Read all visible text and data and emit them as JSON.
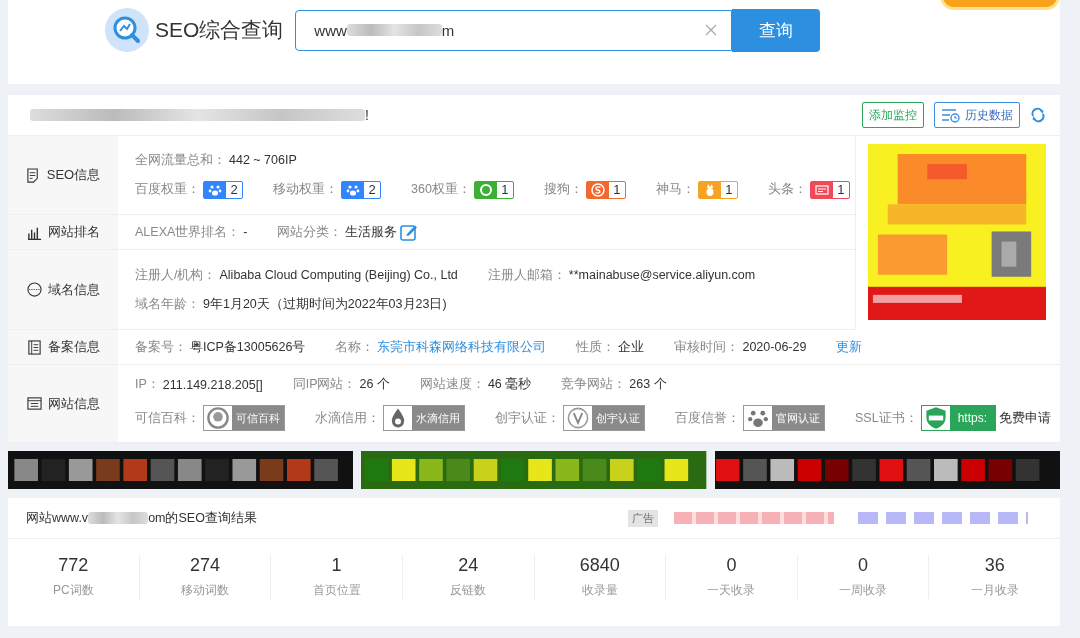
{
  "header": {
    "title": "SEO综合查询",
    "search": {
      "value_start": "www",
      "value_end": "m"
    },
    "button": "查询"
  },
  "report": {
    "title_end": "!",
    "actions": [
      {
        "label": "添加监控",
        "kind": "monitor"
      },
      {
        "label": "历史数据",
        "kind": "history"
      }
    ],
    "sections": [
      {
        "label": "SEO信息",
        "lines": [
          [
            {
              "kind": "text",
              "label": "全网流量总和：",
              "value": "442 ~ 706IP"
            }
          ],
          [
            {
              "kind": "weight",
              "label": "百度权重：",
              "color": "#3385ff",
              "value": "2"
            },
            {
              "kind": "weight",
              "label": "移动权重：",
              "color": "#3385ff",
              "value": "2"
            },
            {
              "kind": "weight",
              "label": "360权重：",
              "color": "#3cb034",
              "value": "1"
            },
            {
              "kind": "weight",
              "label": "搜狗：",
              "color": "#f2682e",
              "value": "1"
            },
            {
              "kind": "weight",
              "label": "神马：",
              "color": "#f5a322",
              "value": "1"
            },
            {
              "kind": "weight",
              "label": "头条：",
              "color": "#f04a5a",
              "value": "1"
            }
          ]
        ]
      },
      {
        "label": "网站排名",
        "lines": [
          [
            {
              "kind": "text",
              "label": "ALEXA世界排名：",
              "value": "-"
            },
            {
              "kind": "edit",
              "label": "网站分类：",
              "value": "生活服务"
            }
          ]
        ]
      },
      {
        "label": "域名信息",
        "lines": [
          [
            {
              "kind": "text",
              "label": "注册人/机构：",
              "value": "Alibaba Cloud Computing (Beijing) Co., Ltd"
            },
            {
              "kind": "text",
              "label": "注册人邮箱：",
              "value": "**mainabuse@service.aliyun.com"
            }
          ],
          [
            {
              "kind": "text",
              "label": "域名年龄：",
              "value": "9年1月20天（过期时间为2022年03月23日)"
            }
          ]
        ]
      },
      {
        "label": "备案信息",
        "lines": [
          [
            {
              "kind": "text",
              "label": "备案号：",
              "value": "粤ICP备13005626号"
            },
            {
              "kind": "link",
              "label": "名称：",
              "value": "东莞市科森网络科技有限公司"
            },
            {
              "kind": "text",
              "label": "性质：",
              "value": "企业"
            },
            {
              "kind": "text",
              "label": "审核时间：",
              "value": "2020-06-29"
            },
            {
              "kind": "action",
              "value": "更新"
            }
          ]
        ]
      },
      {
        "label": "网站信息",
        "lines": [
          [
            {
              "kind": "text",
              "label": "IP：",
              "value": "211.149.218.205[]"
            },
            {
              "kind": "text",
              "label": "同IP网站：",
              "value": "26 个"
            },
            {
              "kind": "text",
              "label": "网站速度：",
              "value": "46 毫秒"
            },
            {
              "kind": "text",
              "label": "竞争网站：",
              "value": "263 个"
            }
          ],
          [
            {
              "kind": "cert",
              "label": "可信百科：",
              "value": "可信百科"
            },
            {
              "kind": "cert",
              "label": "水滴信用：",
              "value": "水滴信用"
            },
            {
              "kind": "cert",
              "label": "创宇认证：",
              "value": "创宇认证"
            },
            {
              "kind": "cert",
              "label": "百度信誉：",
              "value": "官网认证"
            },
            {
              "kind": "ssl",
              "label": "SSL证书：",
              "value": "https:",
              "link": "免费申请"
            }
          ]
        ]
      }
    ]
  },
  "results": {
    "title_start": "网站www.v",
    "title_end": "om的SEO查询结果",
    "ad_tag": "广告",
    "stats": [
      {
        "value": "772",
        "label": "PC词数"
      },
      {
        "value": "274",
        "label": "移动词数"
      },
      {
        "value": "1",
        "label": "首页位置"
      },
      {
        "value": "24",
        "label": "反链数"
      },
      {
        "value": "6840",
        "label": "收录量"
      },
      {
        "value": "0",
        "label": "一天收录"
      },
      {
        "value": "0",
        "label": "一周收录"
      },
      {
        "value": "36",
        "label": "一月收录"
      }
    ]
  }
}
